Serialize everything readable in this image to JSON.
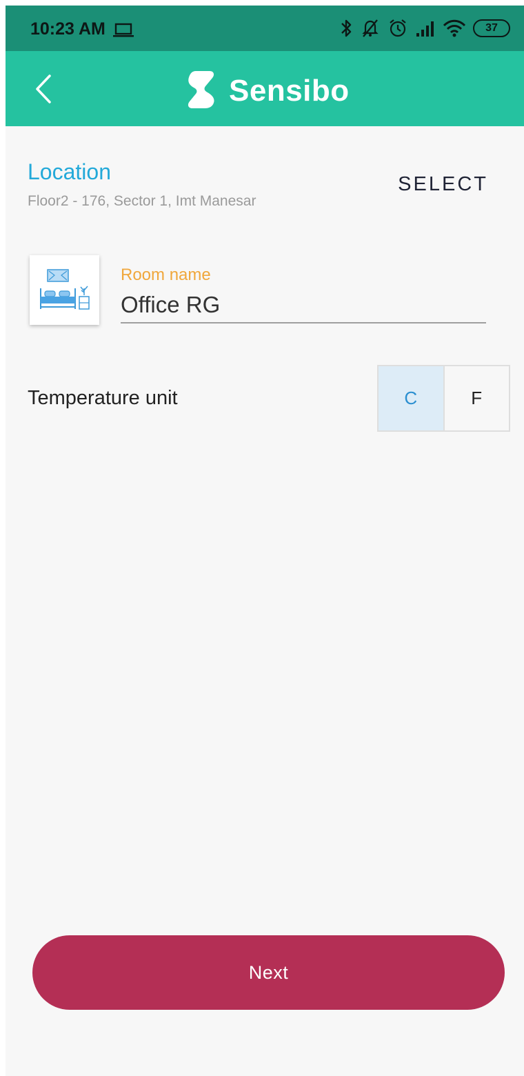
{
  "status_bar": {
    "time": "10:23 AM",
    "battery_level": "37",
    "icons": [
      "laptop-icon",
      "bluetooth-icon",
      "mute-icon",
      "alarm-icon",
      "signal-icon",
      "wifi-icon",
      "battery-icon"
    ]
  },
  "app_bar": {
    "brand_name": "Sensibo",
    "back_icon": "chevron-left-icon",
    "logo_icon": "sensibo-logo-icon",
    "background_color": "#25c2a0"
  },
  "location": {
    "title": "Location",
    "address": "Floor2 - 176, Sector 1, Imt Manesar",
    "select_label": "SELECT"
  },
  "room": {
    "icon": "bedroom-icon",
    "label": "Room name",
    "value": "Office RG"
  },
  "temperature": {
    "label": "Temperature unit",
    "options": [
      "C",
      "F"
    ],
    "selected": "C"
  },
  "actions": {
    "next_label": "Next",
    "next_color": "#b42f55"
  }
}
